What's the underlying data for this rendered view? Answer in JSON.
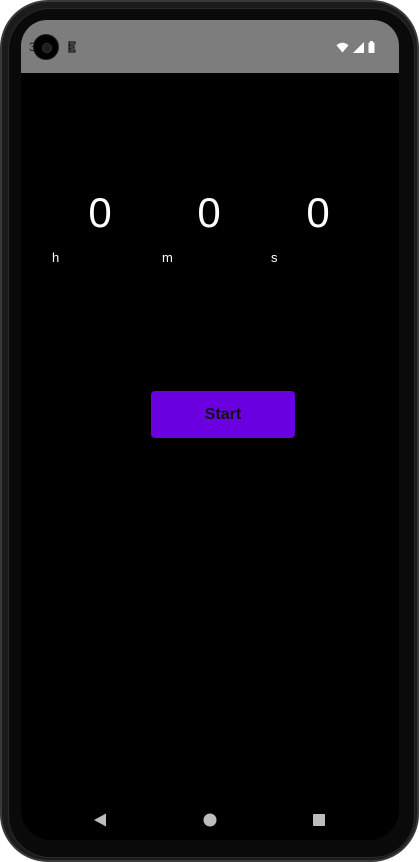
{
  "status_bar": {
    "time": "3"
  },
  "timer": {
    "hours": "0",
    "minutes": "0",
    "seconds": "0",
    "hours_unit": "h",
    "minutes_unit": "m",
    "seconds_unit": "s"
  },
  "actions": {
    "start_label": "Start"
  },
  "colors": {
    "status_bar_bg": "#7d7d7d",
    "screen_bg": "#000000",
    "accent": "#6a00e0",
    "text": "#ffffff"
  },
  "icons": {
    "status_left": [
      "front-camera-icon",
      "app-notification-icon"
    ],
    "status_right": [
      "wifi-icon",
      "signal-icon",
      "battery-icon"
    ],
    "nav": [
      "back-icon",
      "home-icon",
      "recents-icon"
    ]
  }
}
